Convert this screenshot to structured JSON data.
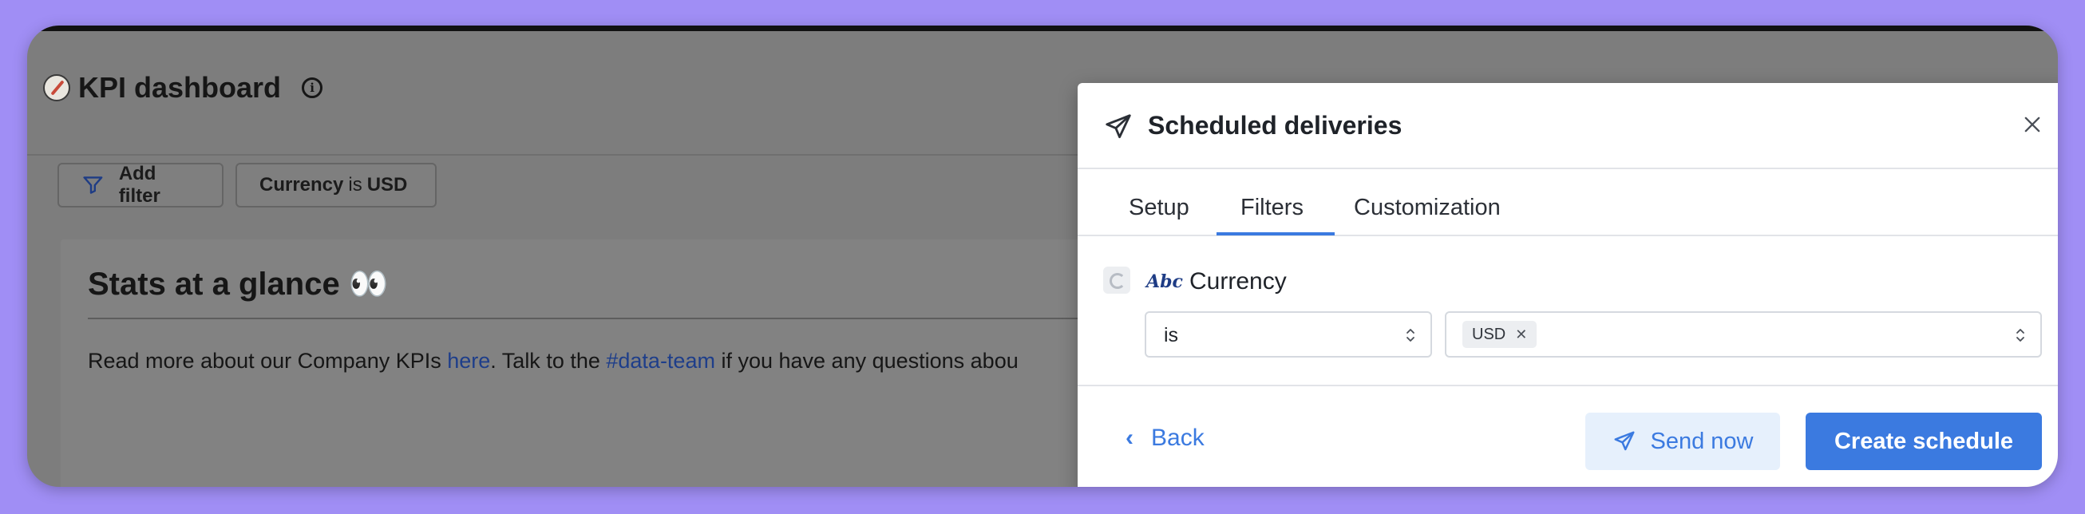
{
  "dashboard": {
    "title": "KPI dashboard",
    "add_filter_label": "Add filter",
    "active_filter": {
      "field": "Currency",
      "operator": "is",
      "value": "USD"
    },
    "card": {
      "title": "Stats at a glance 👀",
      "text_before_link": "Read more about our Company KPIs ",
      "link_here": "here",
      "text_mid": ". Talk to the ",
      "link_team": "#data-team",
      "text_after": " if you have any questions abou"
    }
  },
  "modal": {
    "title": "Scheduled deliveries",
    "tabs": [
      {
        "label": "Setup"
      },
      {
        "label": "Filters",
        "active": true
      },
      {
        "label": "Customization"
      }
    ],
    "filter": {
      "type_icon": "Abc",
      "field": "Currency",
      "operator": "is",
      "values": [
        "USD"
      ]
    },
    "back_label": "Back",
    "send_now_label": "Send now",
    "create_label": "Create schedule",
    "accent_color": "#3b7ae0"
  }
}
